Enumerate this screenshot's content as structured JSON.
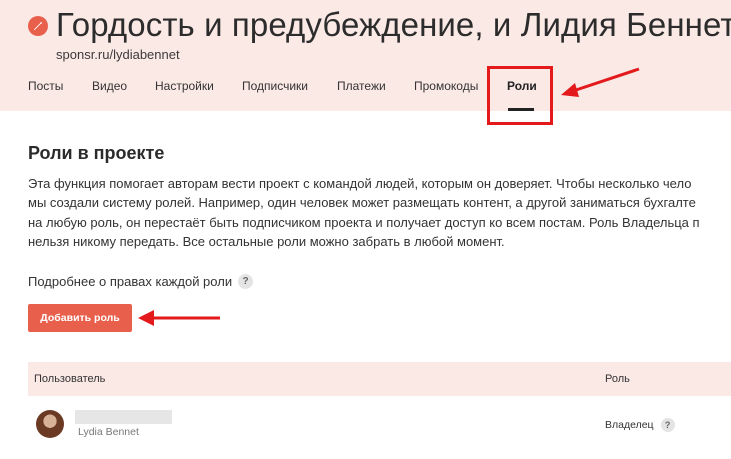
{
  "project": {
    "title": "Гордость и предубеждение, и Лидия Беннет",
    "url": "sponsr.ru/lydiabennet"
  },
  "tabs": [
    {
      "label": "Посты"
    },
    {
      "label": "Видео"
    },
    {
      "label": "Настройки"
    },
    {
      "label": "Подписчики"
    },
    {
      "label": "Платежи"
    },
    {
      "label": "Промокоды"
    },
    {
      "label": "Роли",
      "active": true
    }
  ],
  "roles_section": {
    "title": "Роли в проекте",
    "description_lines": [
      "Эта функция помогает авторам вести проект с командой людей, которым он доверяет. Чтобы несколько чело",
      "мы создали систему ролей. Например, один человек может размещать контент, а другой заниматься бухгалте",
      "на любую роль, он перестаёт быть подписчиком проекта и получает доступ ко всем постам. Роль Владельца п",
      "нельзя никому передать. Все остальные роли можно забрать в любой момент."
    ],
    "more_link": "Подробнее о правах каждой роли",
    "help_glyph": "?",
    "add_button": "Добавить роль"
  },
  "table": {
    "columns": [
      "Пользователь",
      "Роль"
    ],
    "rows": [
      {
        "user_sub": "Lydia Bennet",
        "role": "Владелец"
      }
    ]
  },
  "colors": {
    "accent": "#e8604c",
    "header_bg": "#fbe9e6",
    "annotation_red": "#e3191c"
  },
  "icons": {
    "edit": "pencil-icon",
    "help": "question-icon"
  }
}
